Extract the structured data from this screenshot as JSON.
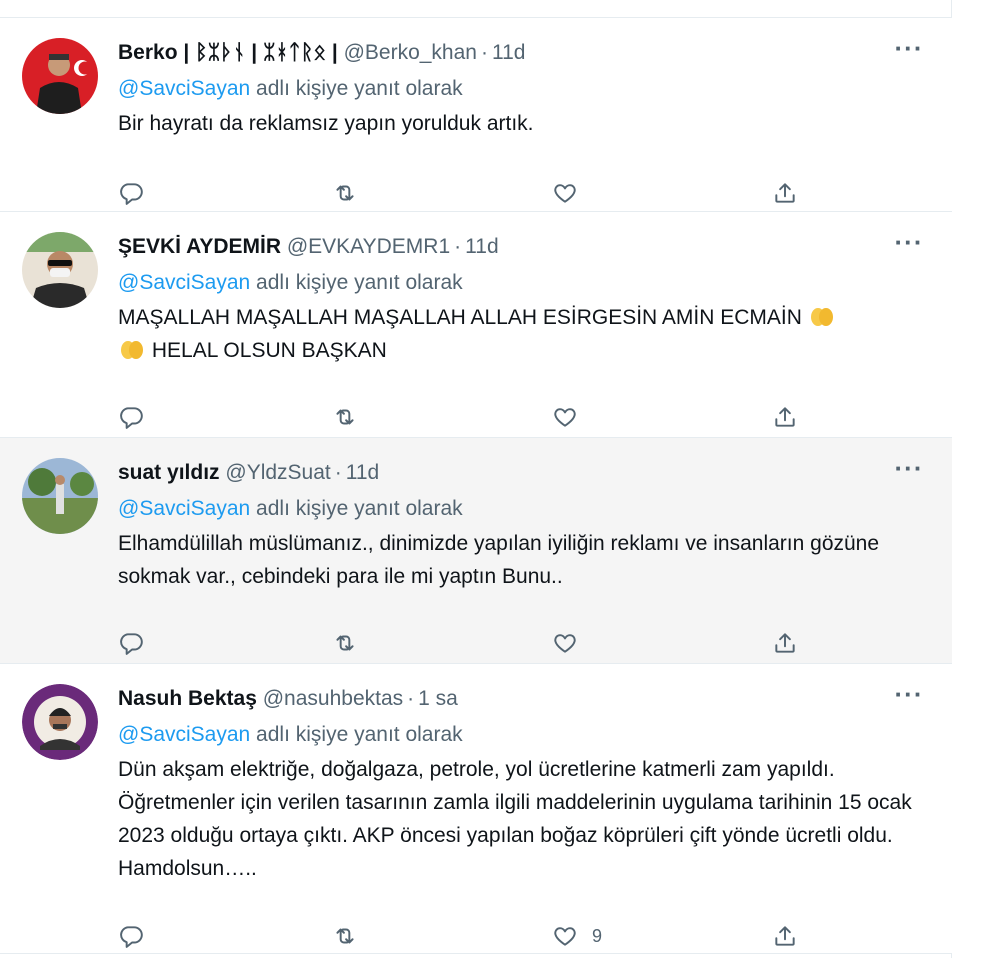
{
  "tweets": [
    {
      "name": "Berko | ᛒᛯᚦᚾ | ᛯᚼᛏᚱᛟ |",
      "handle": "@Berko_khan",
      "time": "11d",
      "reply_prefix": "@SavciSayan",
      "reply_suffix": " adlı kişiye yanıt olarak",
      "text": "Bir hayratı da reklamsız yapın yorulduk artık.",
      "likes": ""
    },
    {
      "name": "ŞEVKİ AYDEMİR",
      "handle": "@EVKAYDEMR1",
      "time": "11d",
      "reply_prefix": "@SavciSayan",
      "reply_suffix": " adlı kişiye yanıt olarak",
      "text_line1": "MAŞALLAH MAŞALLAH MAŞALLAH ALLAH ESİRGESİN AMİN ECMAİN",
      "text_line2": "HELAL OLSUN BAŞKAN",
      "likes": ""
    },
    {
      "name": "suat yıldız",
      "handle": "@YldzSuat",
      "time": "11d",
      "reply_prefix": "@SavciSayan",
      "reply_suffix": " adlı kişiye yanıt olarak",
      "text": "Elhamdülillah müslümanız., dinimizde yapılan iyiliğin reklamı ve insanların gözüne sokmak var., cebindeki para ile mi yaptın Bunu..",
      "likes": ""
    },
    {
      "name": "Nasuh Bektaş",
      "handle": "@nasuhbektas",
      "time": "1 sa",
      "reply_prefix": "@SavciSayan",
      "reply_suffix": " adlı kişiye yanıt olarak",
      "text": "Dün akşam elektriğe, doğalgaza, petrole, yol ücretlerine katmerli zam yapıldı. Öğretmenler için verilen tasarının zamla ilgili maddelerinin uygulama tarihinin 15 ocak 2023 olduğu ortaya çıktı. AKP öncesi yapılan boğaz köprüleri çift yönde ücretli oldu. Hamdolsun…..",
      "likes": "9"
    }
  ],
  "icons": {
    "reply": "reply-icon",
    "retweet": "retweet-icon",
    "like": "heart-icon",
    "share": "share-icon",
    "more": "more-icon"
  },
  "colors": {
    "mention": "#1d9bf0",
    "secondary": "#536471",
    "hover_bg": "#f5f5f5"
  }
}
